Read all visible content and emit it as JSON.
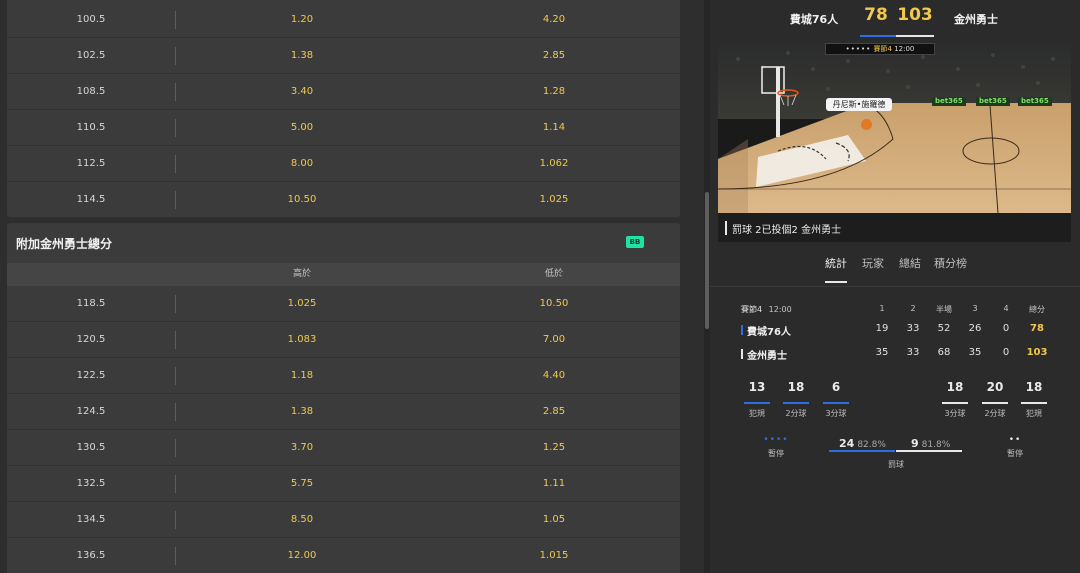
{
  "market1": {
    "rows": [
      {
        "line": "100.5",
        "over": "1.20",
        "under": "4.20"
      },
      {
        "line": "102.5",
        "over": "1.38",
        "under": "2.85"
      },
      {
        "line": "108.5",
        "over": "3.40",
        "under": "1.28"
      },
      {
        "line": "110.5",
        "over": "5.00",
        "under": "1.14"
      },
      {
        "line": "112.5",
        "over": "8.00",
        "under": "1.062"
      },
      {
        "line": "114.5",
        "over": "10.50",
        "under": "1.025"
      }
    ]
  },
  "market2": {
    "title": "附加金州勇士總分",
    "badge": "BB",
    "col_over": "高於",
    "col_under": "低於",
    "rows": [
      {
        "line": "118.5",
        "over": "1.025",
        "under": "10.50"
      },
      {
        "line": "120.5",
        "over": "1.083",
        "under": "7.00"
      },
      {
        "line": "122.5",
        "over": "1.18",
        "under": "4.40"
      },
      {
        "line": "124.5",
        "over": "1.38",
        "under": "2.85"
      },
      {
        "line": "130.5",
        "over": "3.70",
        "under": "1.25"
      },
      {
        "line": "132.5",
        "over": "5.75",
        "under": "1.11"
      },
      {
        "line": "134.5",
        "over": "8.50",
        "under": "1.05"
      },
      {
        "line": "136.5",
        "over": "12.00",
        "under": "1.015"
      }
    ]
  },
  "scoreboard": {
    "home_team": "費城76人",
    "away_team": "金州勇士",
    "home_score": "78",
    "away_score": "103",
    "home_color": "#2d6fe0",
    "away_color": "#e8e8e8"
  },
  "court": {
    "clock_dots": "•••••",
    "quarter": "賽節4",
    "time": "12:00",
    "player_tag": "丹尼斯•施羅德",
    "sponsor": "bet365"
  },
  "event": {
    "text": "罰球 2已投個2 金州勇士"
  },
  "tabs": [
    "統計",
    "玩家",
    "總結",
    "積分榜"
  ],
  "box": {
    "period_label": "賽節4",
    "period_time": "12:00",
    "headers": [
      "1",
      "2",
      "半場",
      "3",
      "4",
      "總分"
    ],
    "teams": [
      {
        "name": "費城76人",
        "color": "#2d6fe0",
        "q": [
          "19",
          "33",
          "52",
          "26",
          "0"
        ],
        "total": "78"
      },
      {
        "name": "金州勇士",
        "color": "#e8e8e8",
        "q": [
          "35",
          "33",
          "68",
          "35",
          "0"
        ],
        "total": "103"
      }
    ]
  },
  "stats": {
    "home": [
      {
        "value": "13",
        "label": "犯規"
      },
      {
        "value": "18",
        "label": "2分球"
      },
      {
        "value": "6",
        "label": "3分球"
      }
    ],
    "away": [
      {
        "value": "18",
        "label": "3分球"
      },
      {
        "value": "20",
        "label": "2分球"
      },
      {
        "value": "18",
        "label": "犯規"
      }
    ],
    "free_throws": {
      "home_made": "24",
      "home_pct": "82.8%",
      "away_made": "9",
      "away_pct": "81.8%",
      "label": "罰球"
    },
    "timeouts": {
      "home_dots": "••••",
      "away_dots": "••",
      "label": "暫停"
    }
  }
}
